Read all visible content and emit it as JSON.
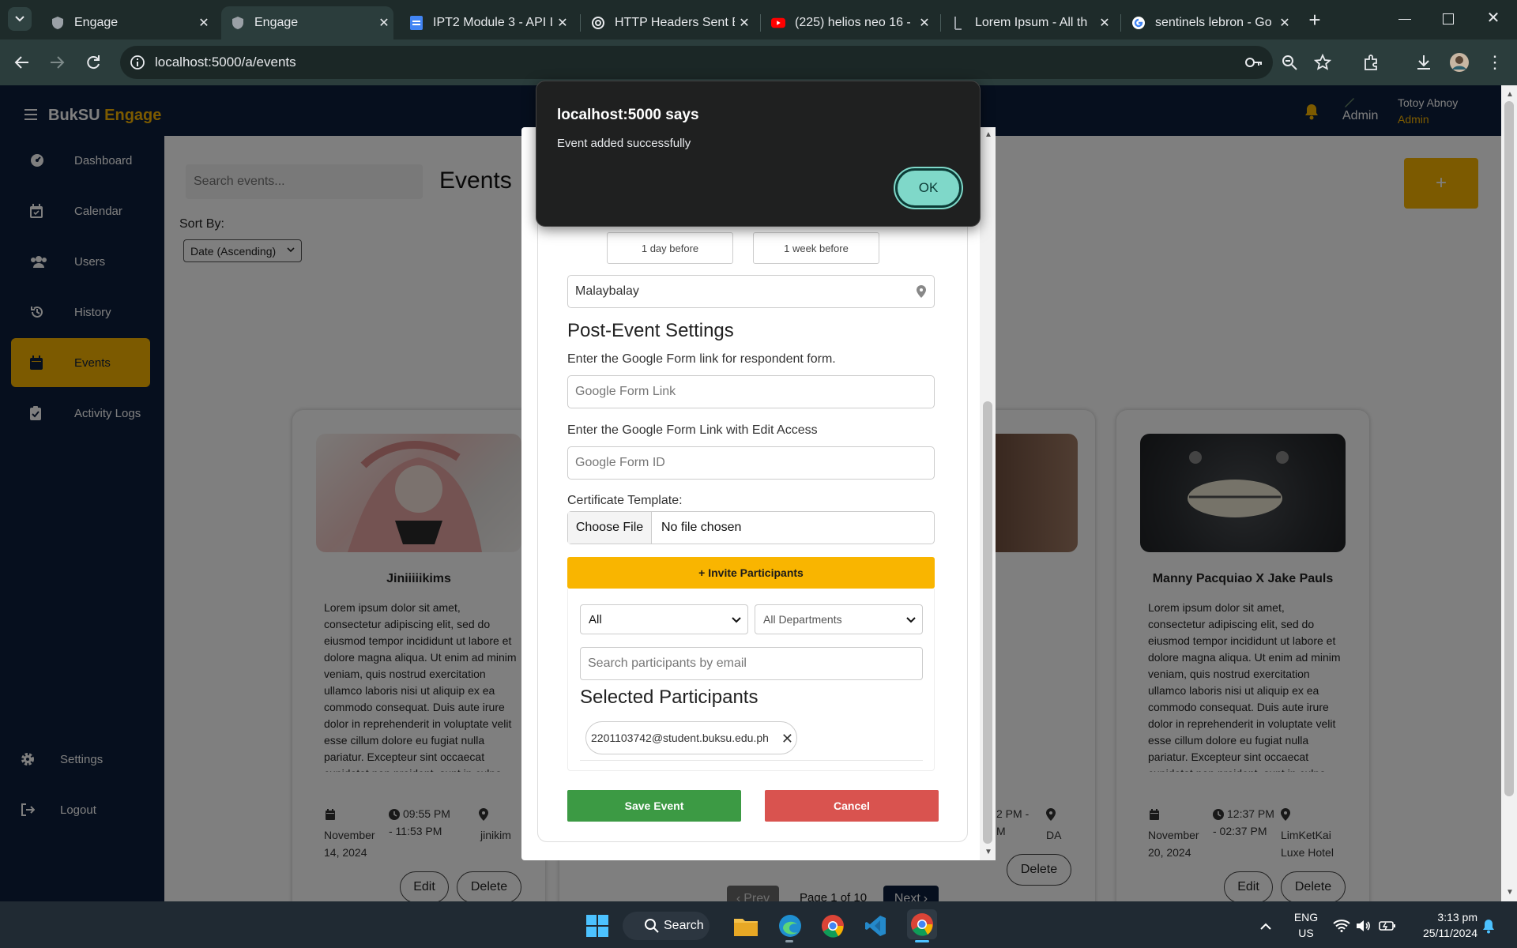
{
  "browser": {
    "tabs": [
      {
        "title": "Engage",
        "active": false,
        "favicon": "engage-icon"
      },
      {
        "title": "Engage",
        "active": true,
        "favicon": "engage-icon"
      },
      {
        "title": "IPT2 Module 3 - API I",
        "active": false,
        "favicon": "docs-icon"
      },
      {
        "title": "HTTP Headers Sent B",
        "active": false,
        "favicon": "chatgpt-icon"
      },
      {
        "title": "(225) helios neo 16 -",
        "active": false,
        "favicon": "youtube-icon"
      },
      {
        "title": "Lorem Ipsum - All th",
        "active": false,
        "favicon": "lipsum-icon"
      },
      {
        "title": "sentinels lebron - Go",
        "active": false,
        "favicon": "google-icon"
      }
    ],
    "url": "localhost:5000/a/events"
  },
  "app": {
    "brand_part1": "BukSU",
    "brand_part2": "Engage",
    "user_role_label": "Admin",
    "user_name": "Totoy Abnoy",
    "user_role": "Admin"
  },
  "sidebar": {
    "items": [
      {
        "label": "Dashboard",
        "icon": "dashboard-icon"
      },
      {
        "label": "Calendar",
        "icon": "calendar-icon"
      },
      {
        "label": "Users",
        "icon": "users-icon"
      },
      {
        "label": "History",
        "icon": "history-icon"
      },
      {
        "label": "Events",
        "icon": "events-icon",
        "active": true
      },
      {
        "label": "Activity Logs",
        "icon": "clipboard-icon"
      }
    ],
    "settings": "Settings",
    "logout": "Logout"
  },
  "events_page": {
    "search_placeholder": "Search events...",
    "title": "Events",
    "sort_label": "Sort By:",
    "sort_value": "Date (Ascending)",
    "add_button": "+",
    "pagination": {
      "prev": "Prev",
      "page": "Page 1 of 10",
      "next": "Next"
    }
  },
  "cards": [
    {
      "title": "Jiniiiiikims",
      "description": "Lorem ipsum dolor sit amet, consectetur adipiscing elit, sed do eiusmod tempor incididunt ut labore et dolore magna aliqua. Ut enim ad minim veniam, quis nostrud exercitation ullamco laboris nisi ut aliquip ex ea commodo consequat. Duis aute irure dolor in reprehenderit in voluptate velit esse cillum dolore eu fugiat nulla pariatur. Excepteur sint occaecat cupidatat non proident, sunt in culpa qui officia deserunt mollit",
      "date": "November 14, 2024",
      "time": "09:55 PM - 11:53 PM",
      "location": "jinikim",
      "edit": "Edit",
      "delete": "Delete"
    },
    {
      "time_partial": "2 PM - M",
      "location_partial": "DA",
      "delete": "Delete"
    },
    {
      "title": "Manny Pacquiao X Jake Pauls",
      "description": "Lorem ipsum dolor sit amet, consectetur adipiscing elit, sed do eiusmod tempor incididunt ut labore et dolore magna aliqua. Ut enim ad minim veniam, quis nostrud exercitation ullamco laboris nisi ut aliquip ex ea commodo consequat. Duis aute irure dolor in reprehenderit in voluptate velit esse cillum dolore eu fugiat nulla pariatur. Excepteur sint occaecat cupidatat non proident, sunt in culpa qui officia deserunt mollit",
      "date": "November 20, 2024",
      "time": "12:37 PM - 02:37 PM",
      "location": "LimKetKai Luxe Hotel",
      "edit": "Edit",
      "delete": "Delete"
    }
  ],
  "modal": {
    "reminder_options": [
      "1 day before",
      "1 week before"
    ],
    "location_value": "Malaybalay",
    "post_event_heading": "Post-Event Settings",
    "form_link_label": "Enter the Google Form link for respondent form.",
    "form_link_placeholder": "Google Form Link",
    "form_edit_label": "Enter the Google Form Link with Edit Access",
    "form_id_placeholder": "Google Form ID",
    "certificate_label": "Certificate Template:",
    "choose_file": "Choose File",
    "no_file": "No file chosen",
    "invite_button": "+ Invite Participants",
    "filter_type": "All",
    "filter_department": "All Departments",
    "participant_search_placeholder": "Search participants by email",
    "selected_heading": "Selected Participants",
    "selected_participants": [
      "2201103742@student.buksu.edu.ph"
    ],
    "save_button": "Save Event",
    "cancel_button": "Cancel"
  },
  "alert": {
    "title": "localhost:5000 says",
    "message": "Event added successfully",
    "ok": "OK"
  },
  "taskbar": {
    "search": "Search",
    "lang_line1": "ENG",
    "lang_line2": "US",
    "time": "3:13 pm",
    "date": "25/11/2024"
  },
  "colors": {
    "accent_gold": "#f9b500",
    "navy": "#0d1f3c",
    "save_green": "#3c9a44",
    "cancel_red": "#d9534f",
    "ok_teal": "#7fd8c9"
  }
}
